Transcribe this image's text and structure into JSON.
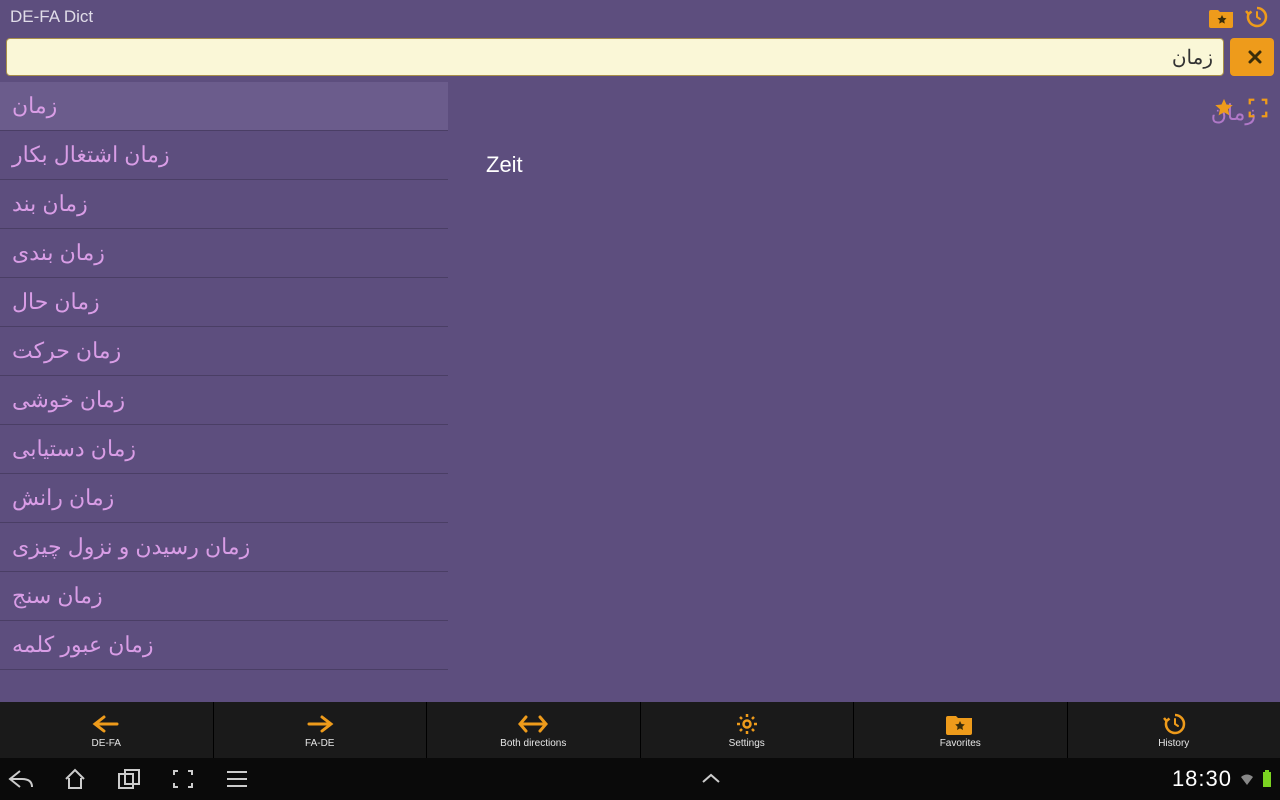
{
  "header": {
    "title": "DE-FA Dict"
  },
  "search": {
    "value": "زمان"
  },
  "results": [
    {
      "text": "زمان",
      "selected": true
    },
    {
      "text": "زمان اشتغال بکار",
      "selected": false
    },
    {
      "text": "زمان بند",
      "selected": false
    },
    {
      "text": "زمان بندی",
      "selected": false
    },
    {
      "text": "زمان حال",
      "selected": false
    },
    {
      "text": "زمان حرکت",
      "selected": false
    },
    {
      "text": "زمان خوشی",
      "selected": false
    },
    {
      "text": "زمان دستیابی",
      "selected": false
    },
    {
      "text": "زمان رانش",
      "selected": false
    },
    {
      "text": "زمان رسیدن و نزول چیزی",
      "selected": false
    },
    {
      "text": "زمان سنج",
      "selected": false
    },
    {
      "text": "زمان عبور کلمه",
      "selected": false
    }
  ],
  "detail": {
    "headword": "زمان",
    "translation": "Zeit"
  },
  "toolbar": [
    {
      "label": "DE-FA",
      "icon": "arrow-left"
    },
    {
      "label": "FA-DE",
      "icon": "arrow-right"
    },
    {
      "label": "Both directions",
      "icon": "arrows-both"
    },
    {
      "label": "Settings",
      "icon": "gear"
    },
    {
      "label": "Favorites",
      "icon": "folder-star"
    },
    {
      "label": "History",
      "icon": "history"
    }
  ],
  "status": {
    "time": "18:30"
  },
  "colors": {
    "accent": "#ee9b1b",
    "bg": "#5d4e7e",
    "listText": "#d99de6"
  }
}
